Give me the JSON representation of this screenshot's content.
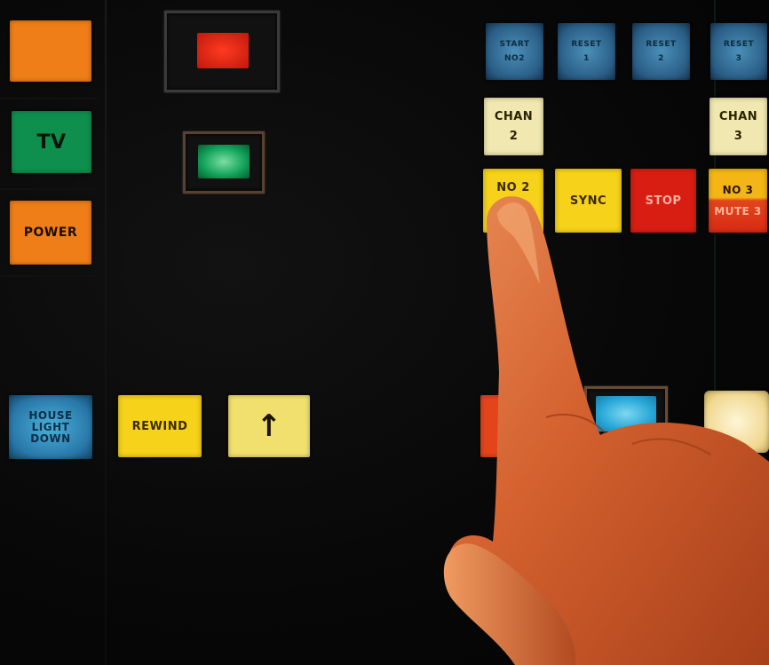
{
  "left_panel": {
    "blank_key": "",
    "tv": "TV",
    "power": "POWER"
  },
  "bottom_row": {
    "house_light_down": [
      "HOUSE",
      "LIGHT",
      "DOWN"
    ],
    "rewind": "REWIND",
    "up_arrow": "↑"
  },
  "right_panel": {
    "blue_keys": [
      {
        "top": "START",
        "bottom": "NO2"
      },
      {
        "top": "RESET",
        "bottom": "1"
      },
      {
        "top": "RESET",
        "bottom": "2"
      },
      {
        "top": "RESET",
        "bottom": "3"
      }
    ],
    "chan_2": {
      "line1": "CHAN",
      "line2": "2"
    },
    "chan_3": {
      "line1": "CHAN",
      "line2": "3"
    },
    "no2": "NO 2",
    "sync": "SYNC",
    "stop": "STOP",
    "no3": "NO 3",
    "mute3": "MUTE 3"
  },
  "colors": {
    "orange": "#f07e18",
    "green": "#0f8f4d",
    "yellow": "#f6d21a",
    "red": "#d81e12",
    "blue": "#2877a8",
    "skin": "#d9653a"
  },
  "icons": {
    "hand": "pointing-hand",
    "arrow": "up-arrow-icon"
  }
}
